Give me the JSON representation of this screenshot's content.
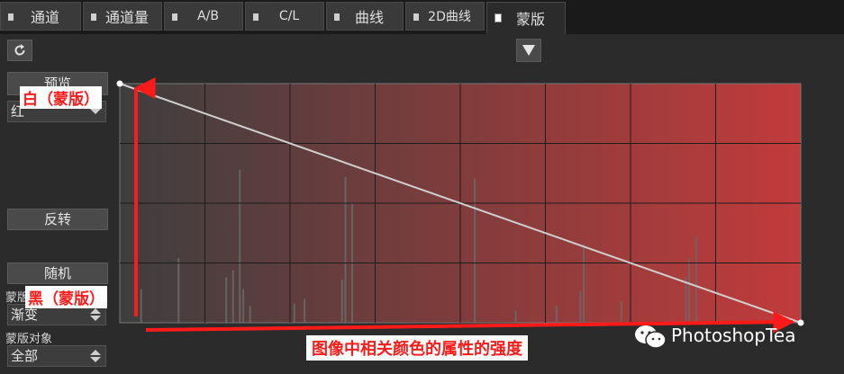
{
  "tabs": [
    {
      "label": "通道",
      "active": false
    },
    {
      "label": "通道量",
      "active": false
    },
    {
      "label": "A/B",
      "active": false
    },
    {
      "label": "C/L",
      "active": false
    },
    {
      "label": "曲线",
      "active": false
    },
    {
      "label": "2D曲线",
      "active": false
    },
    {
      "label": "蒙版",
      "active": true
    }
  ],
  "toolbar": {
    "reset_icon": "refresh-icon",
    "menu_icon": "triangle-down-icon"
  },
  "left_panel": {
    "preview_button": "预览",
    "channel_value": "红",
    "invert_button": "反转",
    "random_button": "随机",
    "mask_type_label": "蒙版类",
    "mask_type_value": "渐变",
    "mask_target_label": "蒙版对象",
    "mask_target_value": "全部"
  },
  "annotations": {
    "white": "白（蒙版）",
    "black": "黑（蒙版）",
    "bottom": "图像中相关颜色的属性的强度"
  },
  "watermark": {
    "text": "PhotoshopTea",
    "icon": "wechat-icon"
  },
  "colors": {
    "gradient_start": "#3e3e3e",
    "gradient_end": "#c23b3b",
    "annotation_red": "#ff1a1a",
    "curve_line": "#cfcfcf"
  },
  "histogram": [
    {
      "x": 0.03,
      "h": 0.14
    },
    {
      "x": 0.085,
      "h": 0.27
    },
    {
      "x": 0.155,
      "h": 0.19
    },
    {
      "x": 0.165,
      "h": 0.22
    },
    {
      "x": 0.175,
      "h": 0.64
    },
    {
      "x": 0.18,
      "h": 0.14
    },
    {
      "x": 0.19,
      "h": 0.07
    },
    {
      "x": 0.255,
      "h": 0.08
    },
    {
      "x": 0.27,
      "h": 0.1
    },
    {
      "x": 0.325,
      "h": 0.18
    },
    {
      "x": 0.33,
      "h": 0.61
    },
    {
      "x": 0.34,
      "h": 0.5
    },
    {
      "x": 0.52,
      "h": 0.6
    },
    {
      "x": 0.58,
      "h": 0.05
    },
    {
      "x": 0.64,
      "h": 0.07
    },
    {
      "x": 0.675,
      "h": 0.13
    },
    {
      "x": 0.68,
      "h": 0.33
    },
    {
      "x": 0.735,
      "h": 0.09
    },
    {
      "x": 0.83,
      "h": 0.19
    },
    {
      "x": 0.835,
      "h": 0.27
    },
    {
      "x": 0.845,
      "h": 0.36
    }
  ]
}
